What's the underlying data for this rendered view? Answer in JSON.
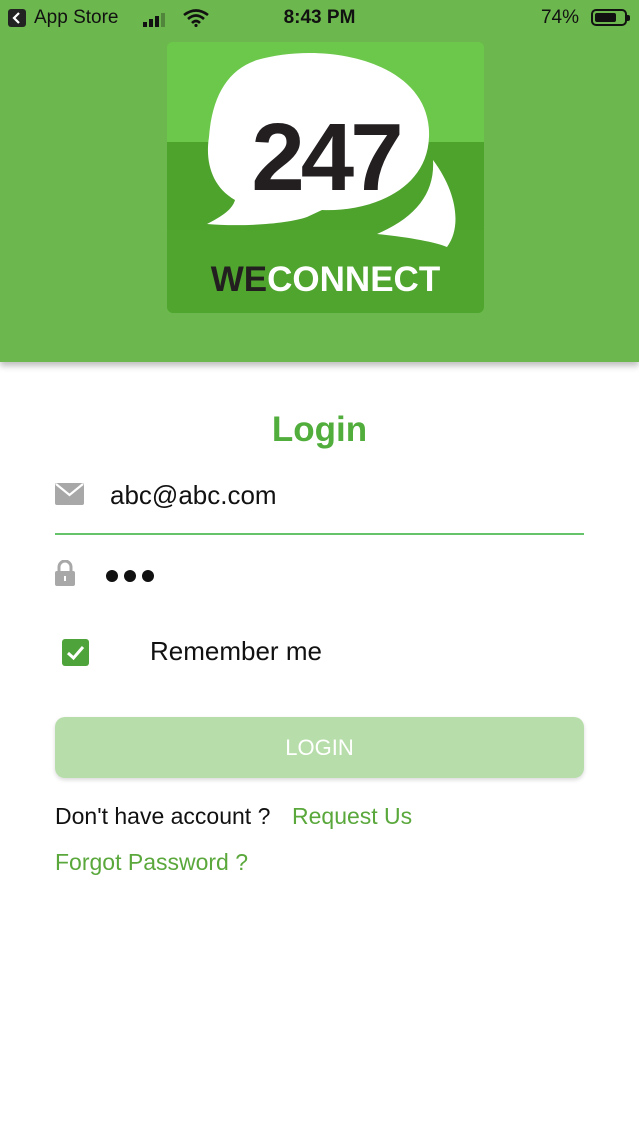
{
  "status_bar": {
    "back_app": "App Store",
    "time": "8:43 PM",
    "battery": "74%",
    "battery_level": 0.74
  },
  "logo": {
    "number": "247",
    "brand_dark": "WE",
    "brand_light": "CONNECT"
  },
  "login": {
    "title": "Login",
    "email_value": "abc@abc.com",
    "password_masked": "•••",
    "remember_label": "Remember me",
    "remember_checked": true,
    "button_label": "LOGIN",
    "no_account_text": "Don't have account ?",
    "request_link": "Request Us",
    "forgot_link": "Forgot Password ?"
  },
  "icons": {
    "email": "mail-icon",
    "password": "lock-icon",
    "checkbox": "check-icon"
  },
  "colors": {
    "header_green": "#6db84e",
    "accent_green": "#52ae3c",
    "button_disabled": "#b7deaa",
    "underline": "#67c36a"
  }
}
